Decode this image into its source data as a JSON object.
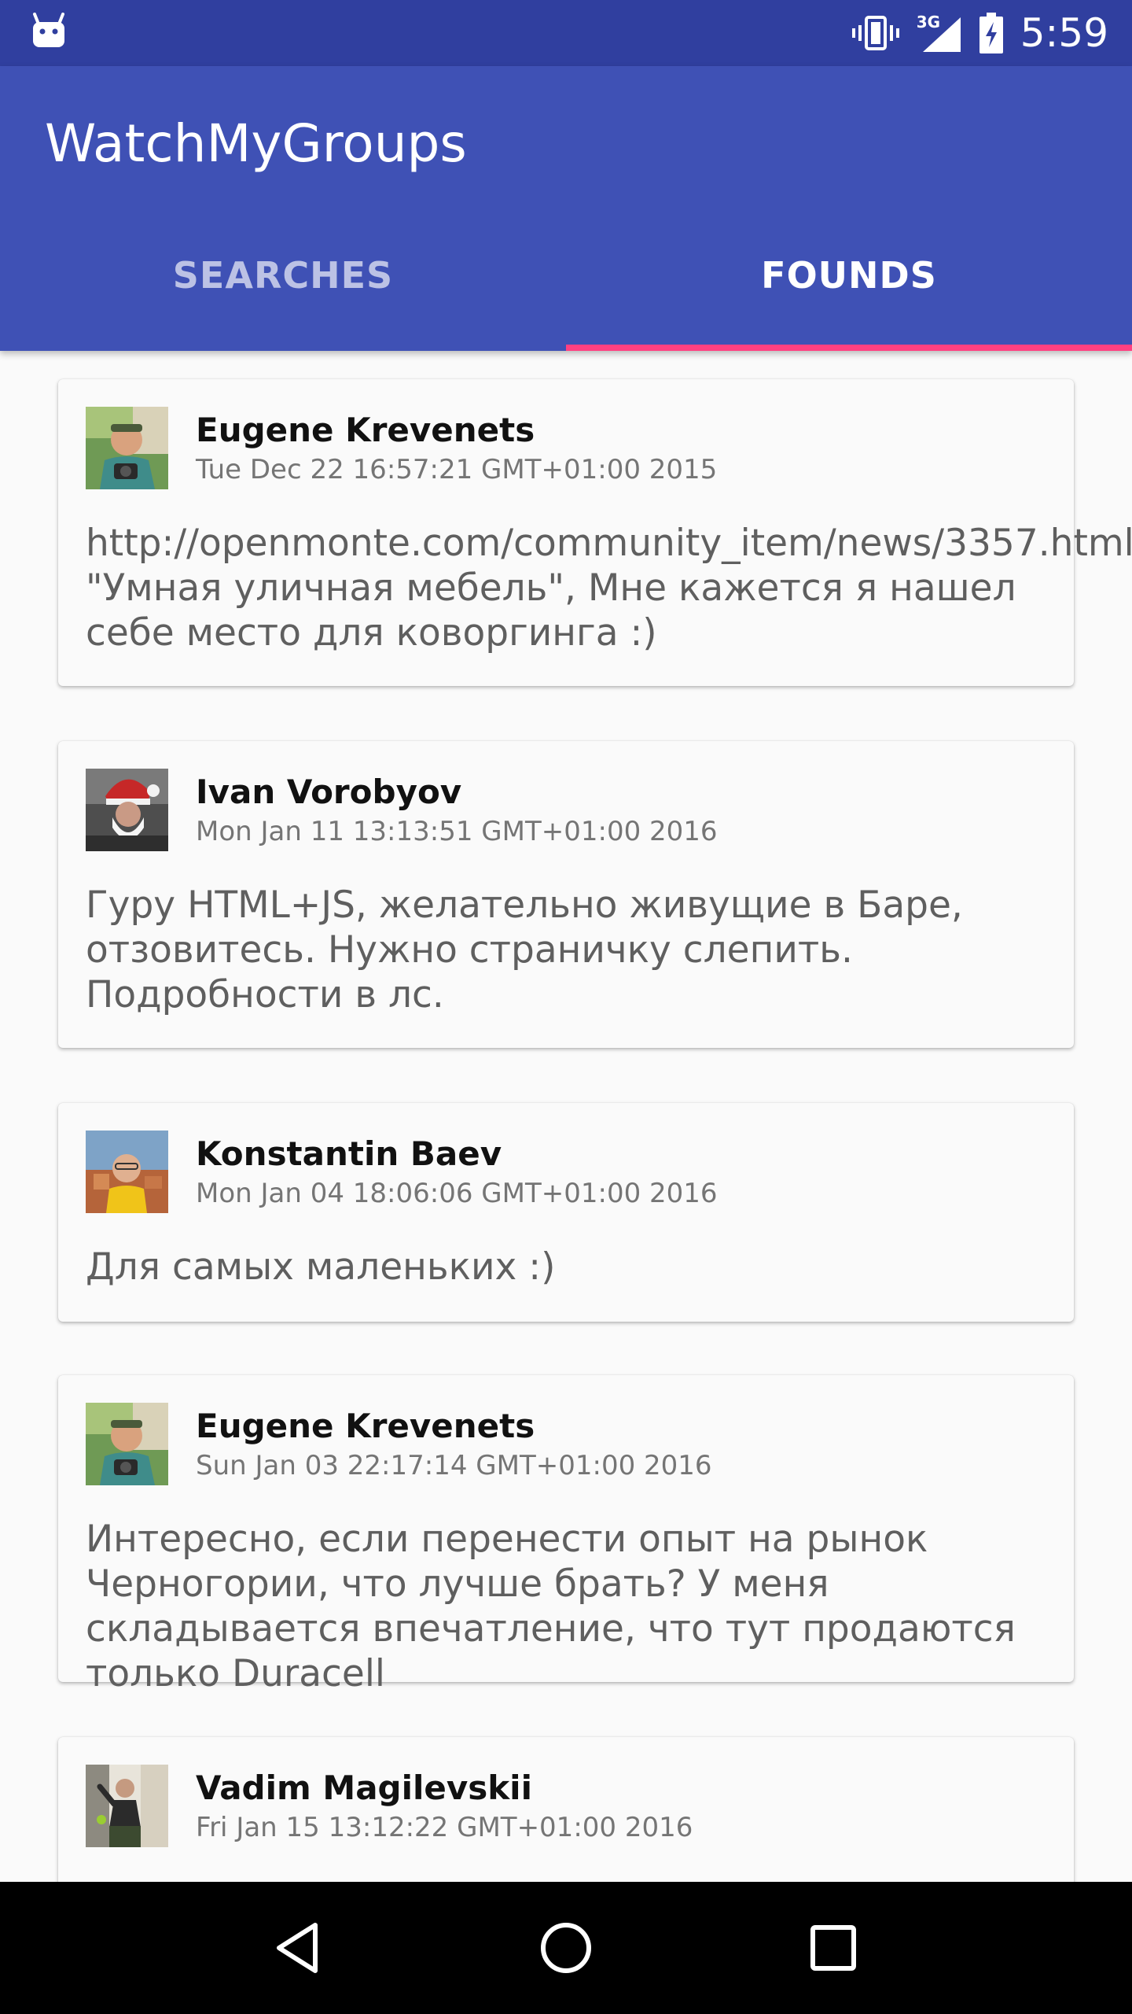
{
  "status_bar": {
    "time": "5:59",
    "network_label": "3G",
    "icons": [
      "android-icon",
      "vibrate-icon",
      "signal-icon",
      "battery-charging-icon"
    ]
  },
  "app": {
    "title": "WatchMyGroups",
    "colors": {
      "primary": "#3f51b5",
      "primary_dark": "#303f9f",
      "accent": "#ff4081"
    }
  },
  "tabs": [
    {
      "label": "SEARCHES",
      "active": false
    },
    {
      "label": "FOUNDS",
      "active": true
    }
  ],
  "posts": [
    {
      "author": "Eugene Krevenets",
      "date": "Tue Dec 22 16:57:21 GMT+01:00 2015",
      "text": "http://openmonte.com/community_item/news/3357.html \"Умная уличная мебель\", Мне кажется я нашел себе место для коворгинга :)"
    },
    {
      "author": "Ivan Vorobyov",
      "date": "Mon Jan 11 13:13:51 GMT+01:00 2016",
      "text": "Гуру HTML+JS, желательно живущие в Баре, отзовитесь. Нужно страничку слепить. Подробности в лс."
    },
    {
      "author": "Konstantin Baev",
      "date": "Mon Jan 04 18:06:06 GMT+01:00 2016",
      "text": "Для самых маленьких :)"
    },
    {
      "author": "Eugene Krevenets",
      "date": "Sun Jan 03 22:17:14 GMT+01:00 2016",
      "text": "Интересно, если перенести опыт на рынок Черногории, что лучше брать? У меня складывается впечатление, что тут продаются только Duracell"
    },
    {
      "author": "Vadim Magilevskii",
      "date": "Fri Jan 15 13:12:22 GMT+01:00 2016",
      "text": ""
    }
  ],
  "nav_bar": {
    "buttons": [
      "back-icon",
      "home-icon",
      "recents-icon"
    ]
  }
}
